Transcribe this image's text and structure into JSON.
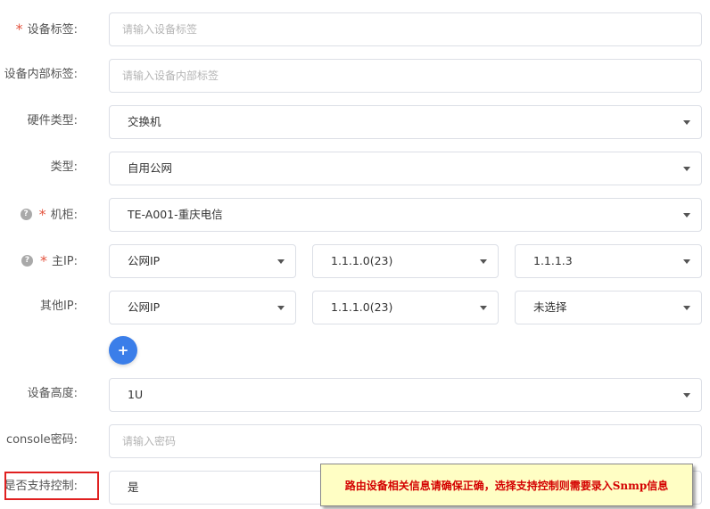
{
  "form": {
    "device_label": {
      "label": "设备标签:",
      "placeholder": "请输入设备标签"
    },
    "device_internal_label": {
      "label": "设备内部标签:",
      "placeholder": "请输入设备内部标签"
    },
    "hardware_type": {
      "label": "硬件类型:",
      "value": "交换机"
    },
    "type": {
      "label": "类型:",
      "value": "自用公网"
    },
    "cabinet": {
      "label": "机柜:",
      "value": "TE-A001-重庆电信"
    },
    "main_ip": {
      "label": "主IP:",
      "network": "公网IP",
      "subnet": "1.1.1.0(23)",
      "address": "1.1.1.3"
    },
    "other_ip": {
      "label": "其他IP:",
      "network": "公网IP",
      "subnet": "1.1.1.0(23)",
      "address": "未选择"
    },
    "add_button": "+",
    "device_height": {
      "label": "设备高度:",
      "value": "1U"
    },
    "console_password": {
      "label": "console密码:",
      "placeholder": "请输入密码"
    },
    "support_control": {
      "label": "是否支持控制:",
      "value": "是"
    }
  },
  "required_mark": "*",
  "help_mark": "?",
  "tooltip": "路由设备相关信息请确保正确，选择支持控制则需要录入Snmp信息",
  "colors": {
    "required": "#e4533e",
    "primary": "#3b7ee9",
    "highlight_border": "#e02020",
    "tooltip_bg": "#fffec4",
    "tooltip_text": "#d40000"
  }
}
